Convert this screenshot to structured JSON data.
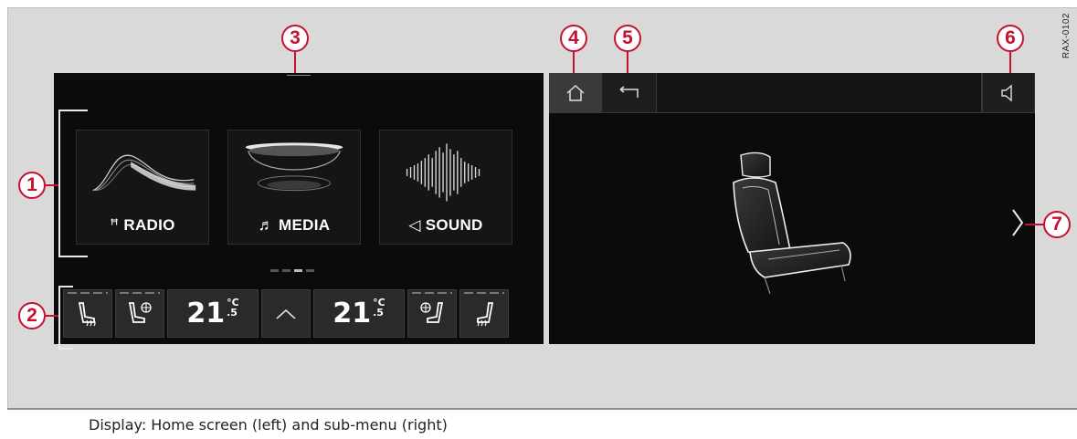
{
  "caption": "Display: Home screen (left) and sub-menu (right)",
  "figure_code": "RAX-0102",
  "callouts": [
    "1",
    "2",
    "3",
    "4",
    "5",
    "6",
    "7"
  ],
  "home_screen": {
    "tiles": [
      {
        "glyph": "ꟸ",
        "label": "RADIO",
        "icon": "radio-icon"
      },
      {
        "glyph": "♬",
        "label": "MEDIA",
        "icon": "music-note-icon"
      },
      {
        "glyph": "◁",
        "label": "SOUND",
        "icon": "speaker-icon"
      }
    ],
    "page_indicator": {
      "count": 4,
      "active": 3
    },
    "climate_bar": {
      "temp_left": "21",
      "temp_left_unit": "°C",
      "temp_left_decimal": ".5",
      "temp_right": "21",
      "temp_right_unit": "°C",
      "temp_right_decimal": ".5",
      "icons": [
        "seat-heating-icon",
        "seat-ventilation-icon",
        "expand-chevron-icon",
        "seat-ventilation-icon",
        "seat-heating-icon"
      ]
    }
  },
  "sub_menu": {
    "top_bar_icons": [
      "home-icon",
      "back-icon",
      "speaker-icon"
    ],
    "content_icon": "seat-icon",
    "next_icon": "chevron-right-icon"
  },
  "colors": {
    "callout": "#c8102e",
    "screen": "#0b0b0b",
    "figure_bg": "#d9d9d9"
  }
}
